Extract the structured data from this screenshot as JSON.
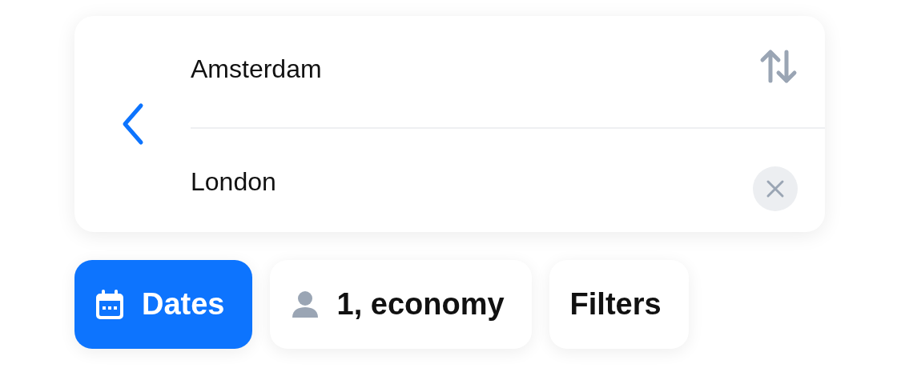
{
  "route": {
    "from": "Amsterdam",
    "to": "London"
  },
  "chips": [
    {
      "kind": "dates",
      "label": "Dates",
      "selected": true
    },
    {
      "kind": "passengers",
      "label": "1, economy",
      "selected": false
    },
    {
      "kind": "filters",
      "label": "Filters",
      "selected": false
    }
  ]
}
